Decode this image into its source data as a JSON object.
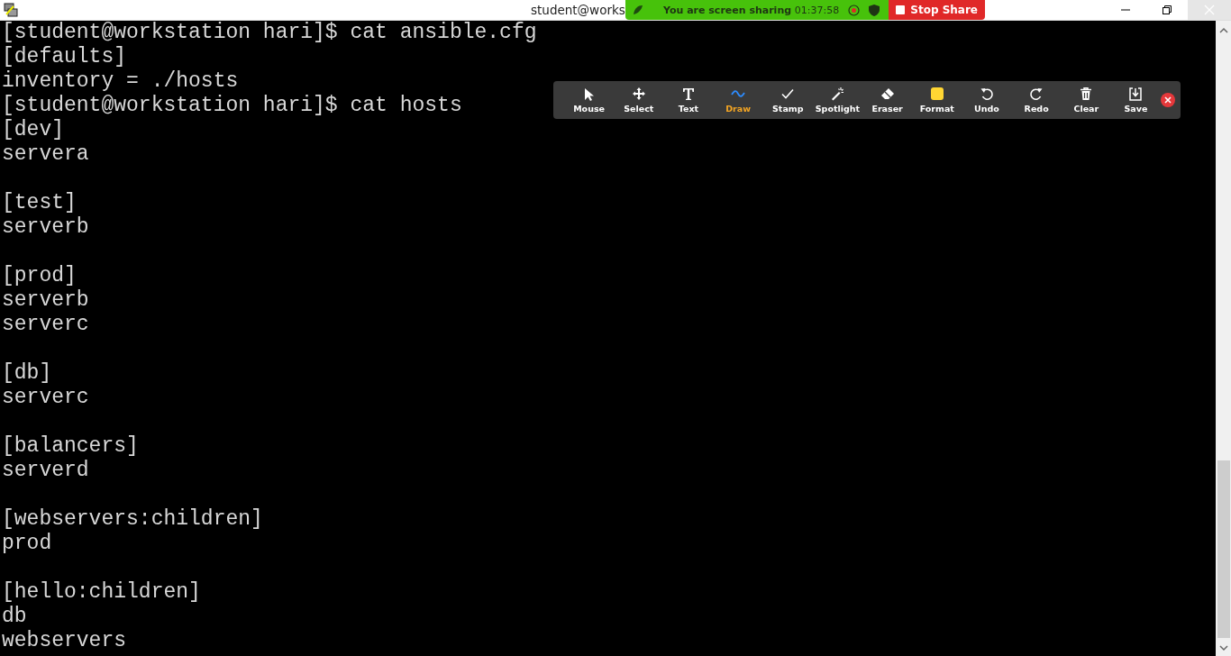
{
  "window": {
    "title": "student@works"
  },
  "sharing_banner": {
    "message": "You are screen sharing",
    "timer": "01:37:58",
    "stop_button": "Stop Share"
  },
  "annotation_toolbar": {
    "tools": [
      {
        "kind": "mouse",
        "label": "Mouse",
        "selected": false
      },
      {
        "kind": "select",
        "label": "Select",
        "selected": false
      },
      {
        "kind": "text",
        "label": "Text",
        "selected": false
      },
      {
        "kind": "draw",
        "label": "Draw",
        "selected": true
      },
      {
        "kind": "stamp",
        "label": "Stamp",
        "selected": false
      },
      {
        "kind": "spotlight",
        "label": "Spotlight",
        "selected": false
      },
      {
        "kind": "eraser",
        "label": "Eraser",
        "selected": false
      },
      {
        "kind": "format",
        "label": "Format",
        "selected": false
      },
      {
        "kind": "undo",
        "label": "Undo",
        "selected": false
      },
      {
        "kind": "redo",
        "label": "Redo",
        "selected": false
      },
      {
        "kind": "clear",
        "label": "Clear",
        "selected": false
      },
      {
        "kind": "save",
        "label": "Save",
        "selected": false
      }
    ]
  },
  "terminal": {
    "blocks": [
      [
        "[student@workstation hari]$ cat ansible.cfg",
        "[defaults]",
        "inventory = ./hosts",
        "[student@workstation hari]$ cat hosts",
        "[dev]",
        "servera"
      ],
      [
        "[test]",
        "serverb"
      ],
      [
        "[prod]",
        "serverb",
        "serverc"
      ],
      [
        "[db]",
        "serverc"
      ],
      [
        "[balancers]",
        "serverd"
      ],
      [
        "[webservers:children]",
        "prod"
      ],
      [
        "[hello:children]",
        "db",
        "webservers"
      ]
    ]
  }
}
